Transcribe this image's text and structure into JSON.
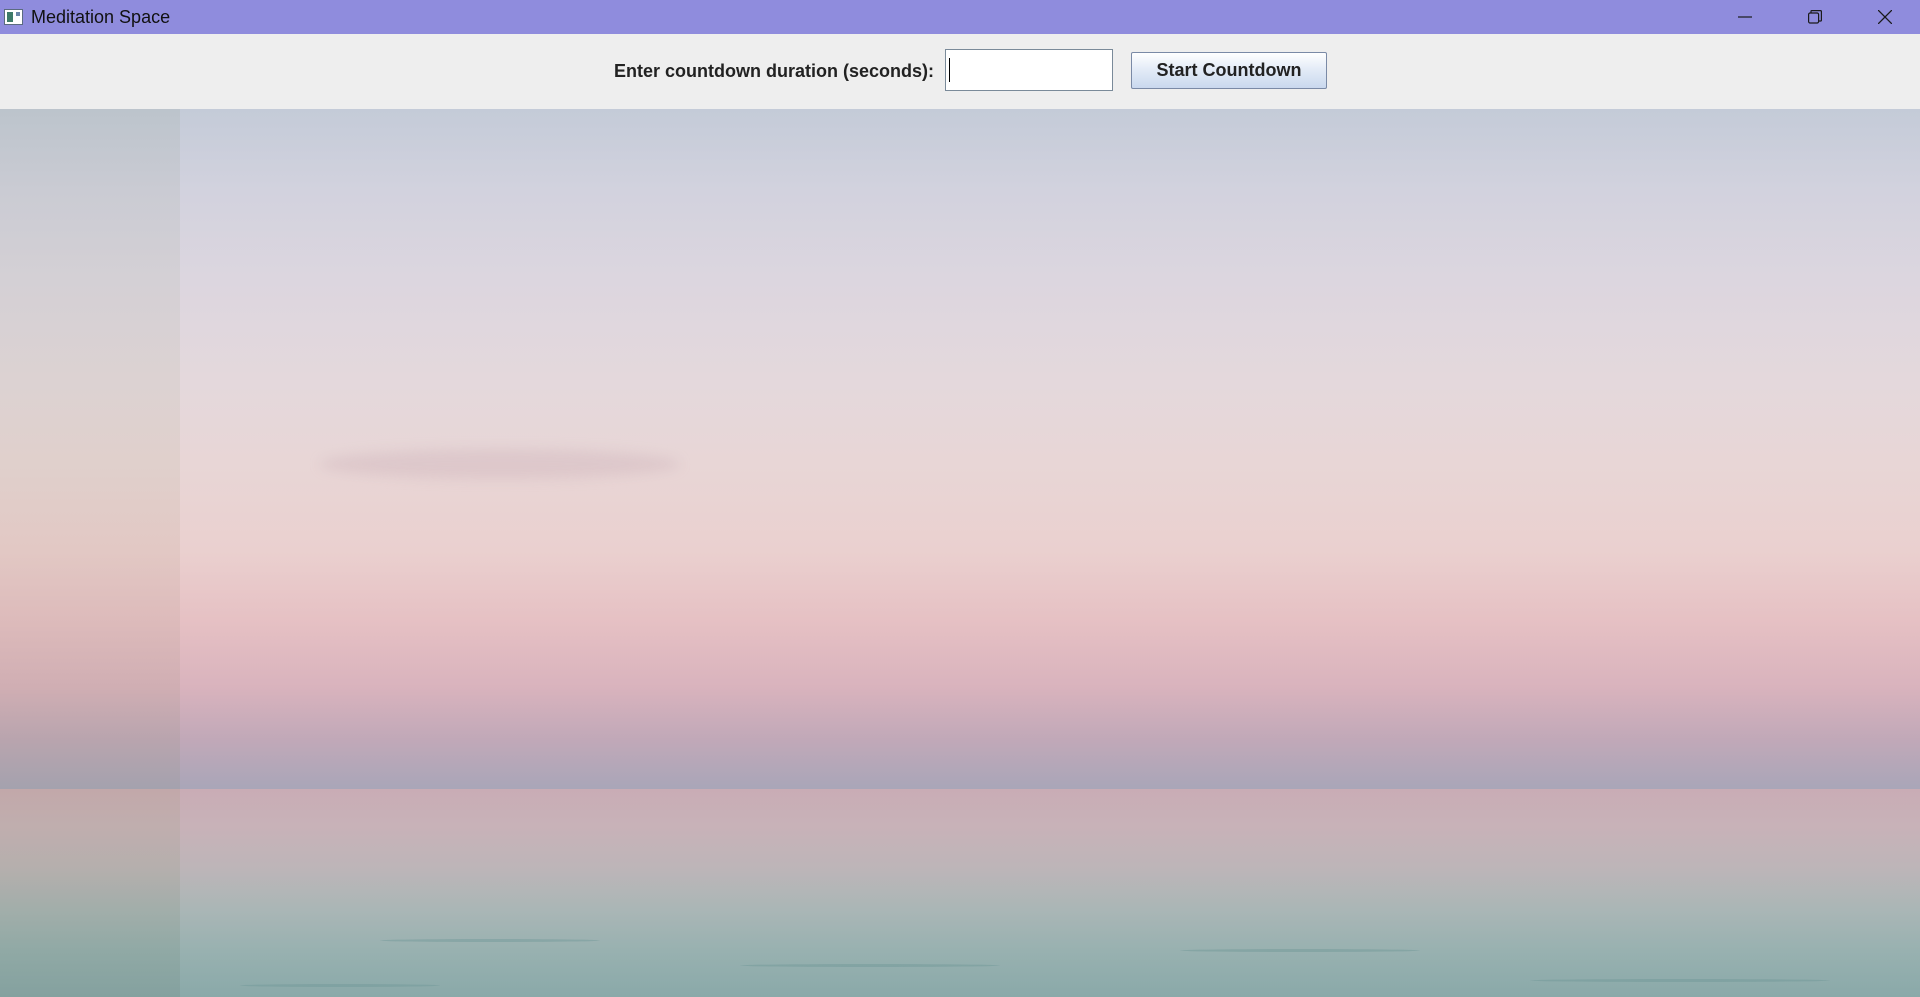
{
  "window": {
    "title": "Meditation Space",
    "controls": {
      "minimize_icon": "minimize-icon",
      "restore_icon": "restore-icon",
      "close_icon": "close-icon"
    },
    "titlebar_color": "#8f8cdd"
  },
  "countdown": {
    "prompt_label": "Enter countdown duration (seconds):",
    "duration_value": "",
    "start_button_label": "Start Countdown"
  },
  "background": {
    "description_icon": "ocean-sunset-image"
  }
}
